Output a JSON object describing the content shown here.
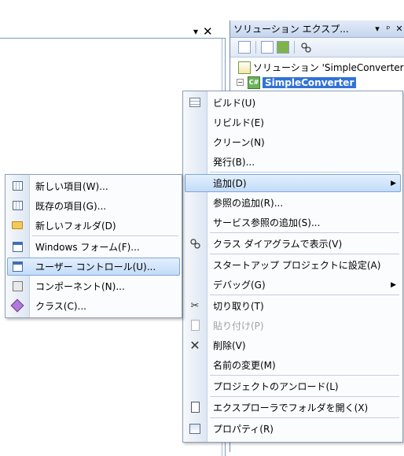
{
  "document": {
    "pin_glyph": "▾",
    "close_glyph": "✕"
  },
  "solution_explorer": {
    "title": "ソリューション エクスプ...",
    "title_buttons": [
      "▾",
      "ᵖ",
      "✕"
    ],
    "tree": {
      "solution_label": "ソリューション 'SimpleConverter",
      "project_label": "SimpleConverter",
      "project_icon_text": "C#"
    }
  },
  "context_menu": {
    "items": [
      {
        "label": "ビルド(U)"
      },
      {
        "label": "リビルド(E)"
      },
      {
        "label": "クリーン(N)"
      },
      {
        "label": "発行(B)..."
      },
      {
        "label": "追加(D)"
      },
      {
        "label": "参照の追加(R)..."
      },
      {
        "label": "サービス参照の追加(S)..."
      },
      {
        "label": "クラス ダイアグラムで表示(V)"
      },
      {
        "label": "スタートアップ プロジェクトに設定(A)"
      },
      {
        "label": "デバッグ(G)"
      },
      {
        "label": "切り取り(T)"
      },
      {
        "label": "貼り付け(P)"
      },
      {
        "label": "削除(V)"
      },
      {
        "label": "名前の変更(M)"
      },
      {
        "label": "プロジェクトのアンロード(L)"
      },
      {
        "label": "エクスプローラでフォルダを開く(X)"
      },
      {
        "label": "プロパティ(R)"
      }
    ],
    "submenu_arrow": "▶"
  },
  "add_submenu": {
    "items": [
      {
        "label": "新しい項目(W)..."
      },
      {
        "label": "既存の項目(G)..."
      },
      {
        "label": "新しいフォルダ(D)"
      },
      {
        "label": "Windows フォーム(F)..."
      },
      {
        "label": "ユーザー コントロール(U)..."
      },
      {
        "label": "コンポーネント(N)..."
      },
      {
        "label": "クラス(C)..."
      }
    ]
  }
}
